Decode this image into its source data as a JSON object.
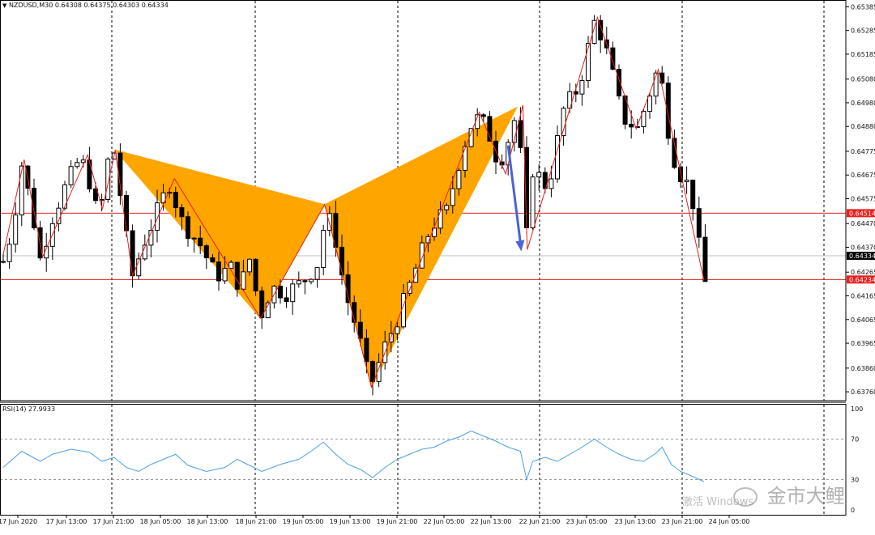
{
  "main_panel": {
    "symbol_header": "NZDUSD,M30  0.64308 0.64375 0.64303 0.64334",
    "menu_arrow_icon": "triangle-down-icon"
  },
  "rsi_panel": {
    "header": "RSI(14) 27.9933",
    "levels": [
      "100",
      "70",
      "30",
      "0"
    ]
  },
  "watermark": {
    "activate_text": "激活 Windows",
    "brand_text": "金市大鲤",
    "brand_icon": "wechat-icon"
  },
  "colors": {
    "candle": "#000000",
    "pattern_fill": "#FFA500",
    "zigzag": "#E8201E",
    "level_line": "#E8201E",
    "current_price_line": "#C0C0C0",
    "arrow": "#4A63D8",
    "rsi_line": "#4A9FEA",
    "grid": "#000000",
    "price_label_red_bg": "#E8201E",
    "price_label_black_bg": "#000000"
  },
  "chart_data": [
    {
      "type": "candlestick",
      "title": "NZDUSD,M30",
      "ohlc_last": {
        "open": 0.64308,
        "high": 0.64375,
        "low": 0.64303,
        "close": 0.64334
      },
      "price_axis": [
        "0.65385",
        "0.65285",
        "0.65185",
        "0.65080",
        "0.64980",
        "0.64880",
        "0.64775",
        "0.64675",
        "0.64575",
        "0.64470",
        "0.64370",
        "0.64265",
        "0.64165",
        "0.64065",
        "0.63965",
        "0.63860",
        "0.63760"
      ],
      "ylim": [
        0.6375,
        0.654
      ],
      "time_axis": [
        "17 Jun 2020",
        "17 Jun 13:00",
        "17 Jun 21:00",
        "18 Jun 05:00",
        "18 Jun 13:00",
        "18 Jun 21:00",
        "19 Jun 05:00",
        "19 Jun 13:00",
        "19 Jun 21:00",
        "22 Jun 05:00",
        "22 Jun 13:00",
        "22 Jun 21:00",
        "23 Jun 05:00",
        "23 Jun 13:00",
        "23 Jun 21:00",
        "24 Jun 05:00"
      ],
      "grid_times": [
        "17 Jun 21:00",
        "18 Jun 21:00",
        "19 Jun 21:00",
        "22 Jun 21:00",
        "23 Jun 21:00"
      ],
      "levels": [
        {
          "price": 0.64514,
          "label": "0.64514",
          "style": "red"
        },
        {
          "price": 0.64234,
          "label": "0.64234",
          "style": "red"
        },
        {
          "price": 0.64334,
          "label": "0.64334",
          "style": "current"
        }
      ],
      "price_path": [
        {
          "t": 0,
          "p": 0.6431
        },
        {
          "t": 1.5,
          "p": 0.6445
        },
        {
          "t": 3,
          "p": 0.6472
        },
        {
          "t": 4.5,
          "p": 0.6455
        },
        {
          "t": 6,
          "p": 0.6432
        },
        {
          "t": 8,
          "p": 0.645
        },
        {
          "t": 10,
          "p": 0.6462
        },
        {
          "t": 12.5,
          "p": 0.6475
        },
        {
          "t": 14,
          "p": 0.6465
        },
        {
          "t": 15.5,
          "p": 0.6448
        },
        {
          "t": 17,
          "p": 0.6473
        },
        {
          "t": 18.2,
          "p": 0.6478
        },
        {
          "t": 19.5,
          "p": 0.6448
        },
        {
          "t": 21,
          "p": 0.6425
        },
        {
          "t": 23,
          "p": 0.644
        },
        {
          "t": 25,
          "p": 0.6452
        },
        {
          "t": 27,
          "p": 0.6464
        },
        {
          "t": 29,
          "p": 0.6448
        },
        {
          "t": 32,
          "p": 0.6438
        },
        {
          "t": 34.5,
          "p": 0.6425
        },
        {
          "t": 37,
          "p": 0.6428
        },
        {
          "t": 38.5,
          "p": 0.642
        },
        {
          "t": 40,
          "p": 0.6432
        },
        {
          "t": 41.8,
          "p": 0.6408
        },
        {
          "t": 43.5,
          "p": 0.642
        },
        {
          "t": 46,
          "p": 0.6418
        },
        {
          "t": 48.5,
          "p": 0.6422
        },
        {
          "t": 51,
          "p": 0.643
        },
        {
          "t": 52.5,
          "p": 0.6452
        },
        {
          "t": 54,
          "p": 0.644
        },
        {
          "t": 55.5,
          "p": 0.6418
        },
        {
          "t": 57.5,
          "p": 0.6402
        },
        {
          "t": 59.6,
          "p": 0.6378
        },
        {
          "t": 62,
          "p": 0.6395
        },
        {
          "t": 64.5,
          "p": 0.641
        },
        {
          "t": 67,
          "p": 0.6428
        },
        {
          "t": 69.5,
          "p": 0.6446
        },
        {
          "t": 72,
          "p": 0.6452
        },
        {
          "t": 74.5,
          "p": 0.6478
        },
        {
          "t": 76.5,
          "p": 0.6492
        },
        {
          "t": 78.5,
          "p": 0.6488
        },
        {
          "t": 80.5,
          "p": 0.6472
        },
        {
          "t": 82.5,
          "p": 0.6486
        },
        {
          "t": 83.6,
          "p": 0.6496
        },
        {
          "t": 84.8,
          "p": 0.6436
        },
        {
          "t": 86,
          "p": 0.647
        },
        {
          "t": 88.5,
          "p": 0.6462
        },
        {
          "t": 91,
          "p": 0.6495
        },
        {
          "t": 93.5,
          "p": 0.6505
        },
        {
          "t": 96.2,
          "p": 0.6534
        },
        {
          "t": 98.5,
          "p": 0.6515
        },
        {
          "t": 100.5,
          "p": 0.6492
        },
        {
          "t": 103,
          "p": 0.6487
        },
        {
          "t": 106,
          "p": 0.651
        },
        {
          "t": 107,
          "p": 0.6505
        },
        {
          "t": 108.5,
          "p": 0.6478
        },
        {
          "t": 110,
          "p": 0.6468
        },
        {
          "t": 111.5,
          "p": 0.6462
        },
        {
          "t": 112.5,
          "p": 0.645
        },
        {
          "t": 113.6,
          "p": 0.6422
        }
      ],
      "zigzag": [
        {
          "t": 0,
          "p": 0.6434
        },
        {
          "t": 3.4,
          "p": 0.6474
        },
        {
          "t": 6.4,
          "p": 0.6433
        },
        {
          "t": 13.7,
          "p": 0.6476
        },
        {
          "t": 16.1,
          "p": 0.6453
        },
        {
          "t": 18.2,
          "p": 0.6478
        },
        {
          "t": 21,
          "p": 0.6425
        },
        {
          "t": 27.8,
          "p": 0.6466
        },
        {
          "t": 41.8,
          "p": 0.6407
        },
        {
          "t": 52.2,
          "p": 0.6455
        },
        {
          "t": 59.8,
          "p": 0.6378
        },
        {
          "t": 77.3,
          "p": 0.6494
        },
        {
          "t": 81.6,
          "p": 0.6468
        },
        {
          "t": 84.4,
          "p": 0.6497
        },
        {
          "t": 85.1,
          "p": 0.6436
        },
        {
          "t": 96.5,
          "p": 0.6534
        },
        {
          "t": 102.8,
          "p": 0.6487
        },
        {
          "t": 106.4,
          "p": 0.6512
        },
        {
          "t": 113.8,
          "p": 0.6423
        }
      ],
      "pattern_triangles": [
        [
          {
            "t": 18.2,
            "p": 0.6478
          },
          {
            "t": 52.2,
            "p": 0.6455
          },
          {
            "t": 41.8,
            "p": 0.6407
          }
        ],
        [
          {
            "t": 52.2,
            "p": 0.6455
          },
          {
            "t": 83.4,
            "p": 0.6496
          },
          {
            "t": 59.8,
            "p": 0.6378
          }
        ]
      ],
      "arrow": {
        "from": {
          "t": 82.0,
          "p": 0.648
        },
        "to": {
          "t": 84.0,
          "p": 0.6436
        }
      }
    },
    {
      "type": "line",
      "title": "RSI(14)",
      "value": 27.9933,
      "ylim": [
        0,
        100
      ],
      "levels": [
        70,
        30
      ],
      "points": [
        {
          "t": 0,
          "v": 42
        },
        {
          "t": 3,
          "v": 58
        },
        {
          "t": 6,
          "v": 48
        },
        {
          "t": 8,
          "v": 55
        },
        {
          "t": 11,
          "v": 60
        },
        {
          "t": 14,
          "v": 57
        },
        {
          "t": 16,
          "v": 48
        },
        {
          "t": 18,
          "v": 52
        },
        {
          "t": 20,
          "v": 42
        },
        {
          "t": 22,
          "v": 38
        },
        {
          "t": 24,
          "v": 45
        },
        {
          "t": 26,
          "v": 50
        },
        {
          "t": 28,
          "v": 55
        },
        {
          "t": 30,
          "v": 44
        },
        {
          "t": 33,
          "v": 38
        },
        {
          "t": 36,
          "v": 42
        },
        {
          "t": 38,
          "v": 50
        },
        {
          "t": 40,
          "v": 44
        },
        {
          "t": 42,
          "v": 38
        },
        {
          "t": 45,
          "v": 45
        },
        {
          "t": 48,
          "v": 50
        },
        {
          "t": 50,
          "v": 58
        },
        {
          "t": 52,
          "v": 67
        },
        {
          "t": 54,
          "v": 55
        },
        {
          "t": 56,
          "v": 45
        },
        {
          "t": 58,
          "v": 40
        },
        {
          "t": 60,
          "v": 32
        },
        {
          "t": 62,
          "v": 42
        },
        {
          "t": 64,
          "v": 50
        },
        {
          "t": 66,
          "v": 55
        },
        {
          "t": 68,
          "v": 60
        },
        {
          "t": 70,
          "v": 62
        },
        {
          "t": 72,
          "v": 68
        },
        {
          "t": 74,
          "v": 72
        },
        {
          "t": 76,
          "v": 78
        },
        {
          "t": 78,
          "v": 73
        },
        {
          "t": 80,
          "v": 68
        },
        {
          "t": 82,
          "v": 62
        },
        {
          "t": 84,
          "v": 58
        },
        {
          "t": 85,
          "v": 30
        },
        {
          "t": 86,
          "v": 48
        },
        {
          "t": 88,
          "v": 52
        },
        {
          "t": 90,
          "v": 48
        },
        {
          "t": 92,
          "v": 55
        },
        {
          "t": 94,
          "v": 62
        },
        {
          "t": 96,
          "v": 70
        },
        {
          "t": 98,
          "v": 62
        },
        {
          "t": 100,
          "v": 55
        },
        {
          "t": 102,
          "v": 50
        },
        {
          "t": 104,
          "v": 48
        },
        {
          "t": 106,
          "v": 56
        },
        {
          "t": 107,
          "v": 62
        },
        {
          "t": 108.5,
          "v": 45
        },
        {
          "t": 110,
          "v": 38
        },
        {
          "t": 112,
          "v": 33
        },
        {
          "t": 113.8,
          "v": 28
        }
      ]
    }
  ]
}
